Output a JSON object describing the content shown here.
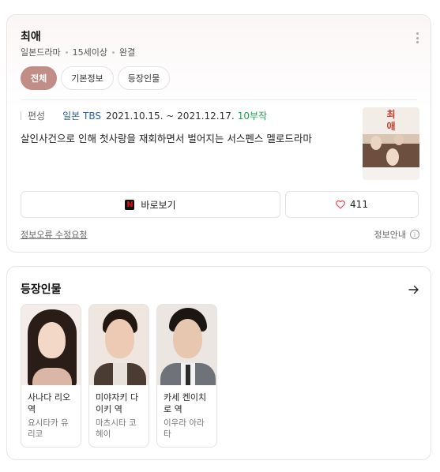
{
  "drama": {
    "title": "최애",
    "country": "일본드라마",
    "rating": "15세이상",
    "status": "완결"
  },
  "tabs": [
    {
      "label": "전체",
      "active": true
    },
    {
      "label": "기본정보",
      "active": false
    },
    {
      "label": "등장인물",
      "active": false
    }
  ],
  "broadcast": {
    "label": "편성",
    "network": "일본 TBS",
    "dates": "2021.10.15. ~ 2021.12.17.",
    "episodes": "10부작"
  },
  "synopsis": "살인사건으로 인해 첫사랑을 재회하면서 벌어지는 서스펜스 멜로드라마",
  "poster": {
    "title_line1": "최",
    "title_line2": "애"
  },
  "actions": {
    "watch_label": "바로보기",
    "watch_icon": "netflix-logo",
    "like_count": "411",
    "like_icon": "heart-icon"
  },
  "footer": {
    "report_label": "정보오류 수정요청",
    "info_label": "정보안내"
  },
  "cast_section": {
    "title": "등장인물",
    "arrow_icon": "arrow-right-icon",
    "members": [
      {
        "role": "사나다 리오 역",
        "actor": "요시타카 유리코"
      },
      {
        "role": "미야자키 다이키 역",
        "actor": "마츠시타 코헤이"
      },
      {
        "role": "카세 켄이치로 역",
        "actor": "이우라 아라타"
      }
    ]
  },
  "colors": {
    "active_tab": "#c08e86",
    "network_link": "#2b5fae",
    "episodes_green": "#21a54f",
    "heart": "#e0475a"
  }
}
